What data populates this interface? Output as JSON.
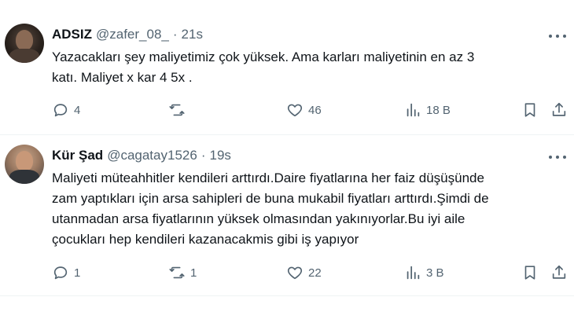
{
  "tweets": [
    {
      "name": "ADSIZ",
      "handle": "@zafer_08_",
      "separator": "·",
      "time": "21s",
      "text": "Yazacakları şey maliyetimiz çok yüksek.  Ama karları maliyetinin en az 3\nkatı.  Maliyet x kar 4 5x .",
      "replies": "4",
      "reposts": "",
      "likes": "46",
      "views": "18 B"
    },
    {
      "name": "Kür Şad",
      "handle": "@cagatay1526",
      "separator": "·",
      "time": "19s",
      "text": "Maliyeti müteahhitler kendileri arttırdı.Daire fiyatlarına her faiz düşüşünde\nzam yaptıkları için arsa sahipleri de buna mukabil fiyatları arttırdı.Şimdi de\nutanmadan arsa fiyatlarının yüksek olmasından yakınıyorlar.Bu iyi aile\nçocukları hep kendileri kazanacakmis gibi iş yapıyor",
      "replies": "1",
      "reposts": "1",
      "likes": "22",
      "views": "3 B"
    }
  ],
  "icons": {
    "reply": "reply-icon",
    "repost": "repost-icon",
    "like": "heart-icon",
    "views": "views-icon",
    "bookmark": "bookmark-icon",
    "share": "share-icon",
    "more": "more-icon"
  },
  "colors": {
    "text": "#0f1419",
    "secondary": "#536471",
    "divider": "#eff3f4"
  }
}
